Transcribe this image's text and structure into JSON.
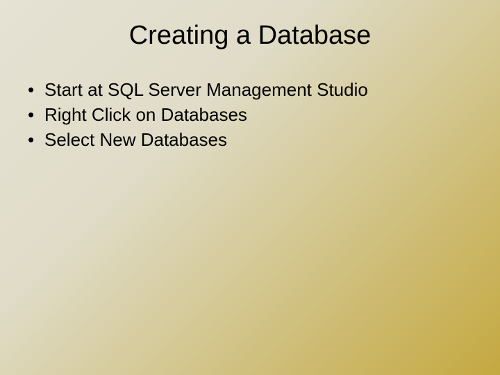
{
  "slide": {
    "title": "Creating a Database",
    "bullets": [
      "Start at SQL Server Management Studio",
      "Right Click on Databases",
      "Select New Databases"
    ]
  }
}
